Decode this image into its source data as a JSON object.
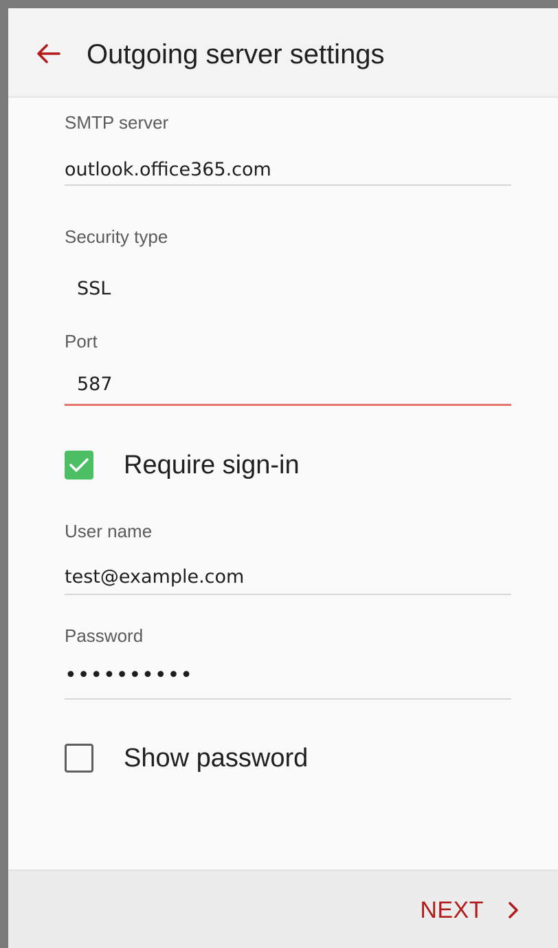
{
  "header": {
    "title": "Outgoing server settings",
    "back_icon": "arrow-left-icon"
  },
  "form": {
    "smtp_server": {
      "label": "SMTP server",
      "value": "outlook.office365.com"
    },
    "security_type": {
      "label": "Security type",
      "value": "SSL"
    },
    "port": {
      "label": "Port",
      "value": "587"
    },
    "require_signin": {
      "label": "Require sign-in",
      "checked": true
    },
    "username": {
      "label": "User name",
      "value": "test@example.com"
    },
    "password": {
      "label": "Password",
      "value": "••••••••••"
    },
    "show_password": {
      "label": "Show password",
      "checked": false
    }
  },
  "footer": {
    "next_label": "NEXT",
    "next_icon": "chevron-right-icon"
  },
  "colors": {
    "accent": "#b21b1b",
    "checkbox_checked": "#4cbe63",
    "active_underline": "#e8756d"
  }
}
